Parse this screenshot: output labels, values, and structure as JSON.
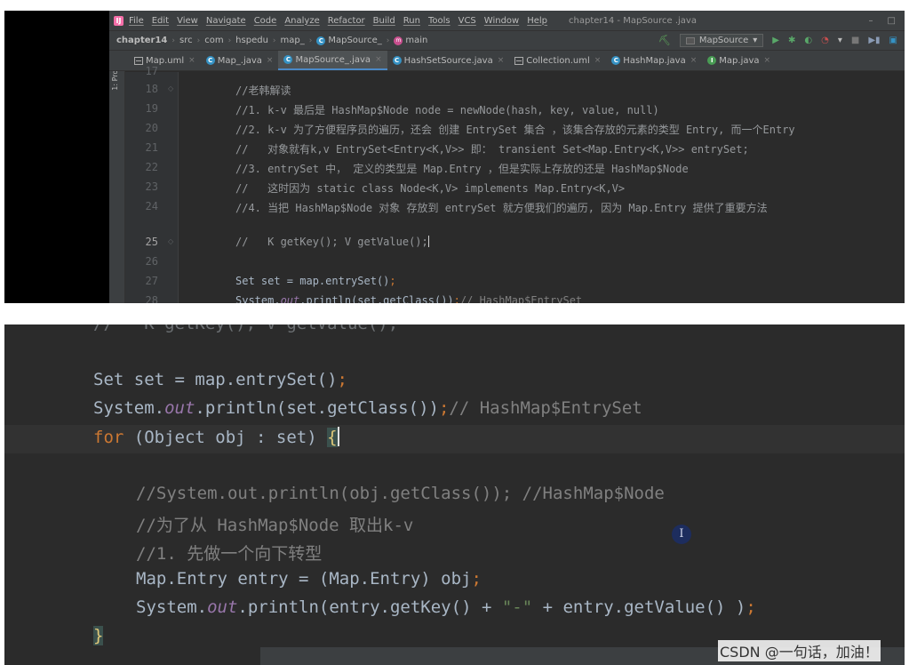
{
  "window": {
    "logo": "IJ",
    "title": "chapter14 - MapSource .java",
    "controls": [
      "–",
      "□"
    ]
  },
  "menu": [
    "File",
    "Edit",
    "View",
    "Navigate",
    "Code",
    "Analyze",
    "Refactor",
    "Build",
    "Run",
    "Tools",
    "VCS",
    "Window",
    "Help"
  ],
  "breadcrumbs": {
    "project": "chapter14",
    "items": [
      "src",
      "com",
      "hspedu",
      "map_",
      "MapSource_",
      "main"
    ],
    "method_icon": "m"
  },
  "toolbar": {
    "run_config": "MapSource",
    "run_config_arrow": "▾",
    "hammer": "⛏",
    "run": "▶",
    "debug": "✱",
    "coverage": "◐",
    "profile": "◔",
    "profile_arrow": "▾",
    "stop": "■",
    "build": "▶▮",
    "project_structure": "▣"
  },
  "side_panel": {
    "label": "1: Project"
  },
  "tabs": [
    {
      "label": "Map.uml",
      "icon": "uml-icon"
    },
    {
      "label": "Map_.java",
      "icon": "class-icon"
    },
    {
      "label": "MapSource_.java",
      "icon": "class-icon",
      "active": true
    },
    {
      "label": "HashSetSource.java",
      "icon": "class-icon"
    },
    {
      "label": "Collection.uml",
      "icon": "uml-icon"
    },
    {
      "label": "HashMap.java",
      "icon": "class-icon"
    },
    {
      "label": "Map.java",
      "icon": "interface-icon"
    }
  ],
  "tab_close": "×",
  "class_icon_letter": "C",
  "interface_icon_letter": "I",
  "top_editor": {
    "partial_line_number": "17",
    "current_line": "25",
    "fold_glyph": "◇",
    "lines": [
      {
        "n": "18",
        "text": "//老韩解读"
      },
      {
        "n": "19",
        "text": "//1. k-v 最后是 HashMap$Node node = newNode(hash, key, value, null)"
      },
      {
        "n": "20",
        "text": "//2. k-v 为了方便程序员的遍历，还会 创建 EntrySet 集合 ，该集合存放的元素的类型 Entry, 而一个Entry"
      },
      {
        "n": "21",
        "text": "//   对象就有k,v EntrySet<Entry<K,V>> 即： transient Set<Map.Entry<K,V>> entrySet;"
      },
      {
        "n": "22",
        "text": "//3. entrySet 中， 定义的类型是 Map.Entry ，但是实际上存放的还是 HashMap$Node"
      },
      {
        "n": "23",
        "text": "//   这时因为 static class Node<K,V> implements Map.Entry<K,V>"
      },
      {
        "n": "24",
        "text": "//4. 当把 HashMap$Node 对象 存放到 entrySet 就方便我们的遍历, 因为 Map.Entry 提供了重要方法"
      },
      {
        "n": "25",
        "text": "//   K getKey(); V getValue();"
      },
      {
        "n": "26",
        "text": ""
      },
      {
        "n": "27",
        "text": "Set set = map.entrySet();"
      },
      {
        "n": "28",
        "text": "System.out.println(set.getClass());// HashMap$EntrySet"
      }
    ]
  },
  "bottom_editor": {
    "partial": "//   K getKey(); V getValue();",
    "l1_a": "Set set = map.entrySet()",
    "semi": ";",
    "l2_a": "System.",
    "l2_out": "out",
    "l2_b": ".println(set.getClass())",
    "l2_c": "// HashMap$EntrySet",
    "for_kw": "for",
    "for_rest": " (Object obj : set) ",
    "open_brace": "{",
    "c1": "//System.out.println(obj.getClass()); //HashMap$Node",
    "c2": "//为了从 HashMap$Node 取出k-v",
    "c3": "//1. 先做一个向下转型",
    "l6": "Map.Entry entry = (Map.Entry) obj",
    "l7_a": "System.",
    "l7_out": "out",
    "l7_b": ".println(entry.getKey() + ",
    "l7_str": "\"-\"",
    "l7_c": " + entry.getValue() )",
    "close_brace": "}",
    "cursor_glyph": "I"
  },
  "watermark": "CSDN @一句话，加油！"
}
